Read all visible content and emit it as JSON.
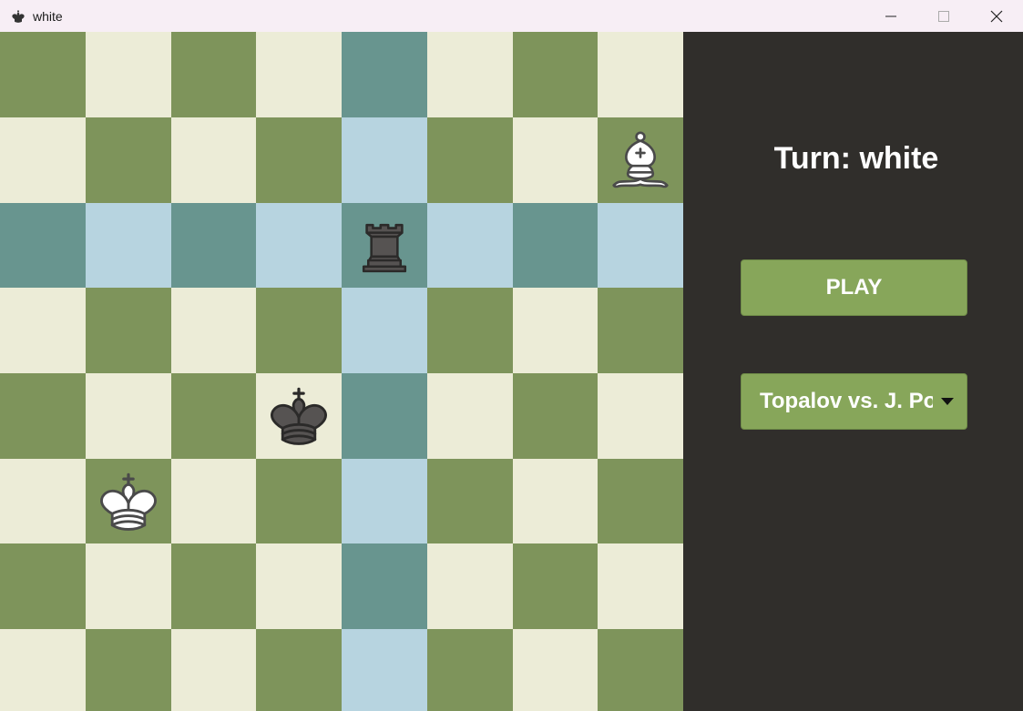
{
  "window": {
    "title": "white",
    "app_icon": "black-king-icon"
  },
  "colors": {
    "light": "#ececd7",
    "dark": "#7e945b",
    "hl_light": "#b7d4e0",
    "hl_dark": "#68958f",
    "button": "#87a65a",
    "panel": "#302e2b"
  },
  "board": {
    "highlighted_squares": [
      "e8",
      "e7",
      "e6",
      "e5",
      "e4",
      "e3",
      "e2",
      "e1",
      "a6",
      "b6",
      "c6",
      "d6",
      "f6",
      "g6",
      "h6"
    ],
    "pieces": [
      {
        "square": "h7",
        "piece": "bishop",
        "color": "white",
        "icon": "white-bishop-icon"
      },
      {
        "square": "e6",
        "piece": "rook",
        "color": "black",
        "icon": "black-rook-icon"
      },
      {
        "square": "d4",
        "piece": "king",
        "color": "black",
        "icon": "black-king-icon"
      },
      {
        "square": "b3",
        "piece": "king",
        "color": "white",
        "icon": "white-king-icon"
      }
    ]
  },
  "panel": {
    "turn_label": "Turn: white",
    "play_label": "PLAY",
    "game_select": "Topalov vs. J. Po"
  }
}
